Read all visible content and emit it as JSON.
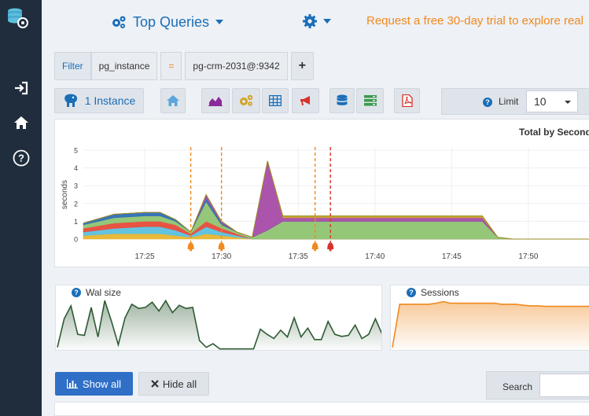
{
  "header": {
    "title": "Top Queries",
    "promo": "Request a free 30-day trial to explore real"
  },
  "filter": {
    "label": "Filter",
    "field": "pg_instance",
    "operator": "=",
    "value": "pg-crm-2031@:9342",
    "add_symbol": "+"
  },
  "toolbar": {
    "instance_label": "1 Instance",
    "limit_label": "Limit",
    "limit_value": "10",
    "colors": {
      "home": "#5ba6dc",
      "area": "#8b2a9a",
      "gears": "#d3a321",
      "grid": "#1a6eb8",
      "announce": "#d9322a",
      "database": "#1a6eb8",
      "server": "#3a9a4a",
      "pdf": "#d9322a"
    }
  },
  "main_chart": {
    "title": "Total by Seconds",
    "chart_data": {
      "type": "area",
      "ylabel": "seconds",
      "ylim": [
        0,
        5
      ],
      "yticks": [
        "0",
        "1",
        "2",
        "3",
        "4",
        "5"
      ],
      "xticks": [
        "17:25",
        "17:30",
        "17:35",
        "17:40",
        "17:45",
        "17:50"
      ],
      "x_minutes": [
        0,
        2,
        4,
        5,
        6,
        7,
        8,
        9,
        10,
        11,
        12,
        13,
        14,
        15,
        16,
        17,
        18,
        19,
        20,
        21,
        22,
        23,
        24,
        25,
        26,
        27,
        28,
        29,
        30,
        31,
        32,
        33
      ],
      "xtick_minutes": [
        4,
        9,
        14,
        19,
        24,
        29
      ],
      "series": [
        {
          "color": "#e8b530",
          "values": [
            0.2,
            0.3,
            0.3,
            0.3,
            0.2,
            0.1,
            0.3,
            0.2,
            0.1,
            0,
            0,
            0,
            0,
            0,
            0,
            0,
            0,
            0,
            0,
            0,
            0,
            0,
            0,
            0,
            0,
            0,
            0,
            0,
            0,
            0,
            0,
            0
          ]
        },
        {
          "color": "#5bc0de",
          "values": [
            0.2,
            0.3,
            0.4,
            0.4,
            0.3,
            0.1,
            0.4,
            0.2,
            0.1,
            0,
            0,
            0,
            0,
            0,
            0,
            0,
            0,
            0,
            0,
            0,
            0,
            0,
            0,
            0,
            0,
            0,
            0,
            0,
            0,
            0,
            0,
            0
          ]
        },
        {
          "color": "#e84a3a",
          "values": [
            0.2,
            0.3,
            0.3,
            0.3,
            0.3,
            0.1,
            0.3,
            0.2,
            0.1,
            0,
            0,
            0,
            0,
            0,
            0,
            0,
            0,
            0,
            0,
            0,
            0,
            0,
            0,
            0,
            0,
            0,
            0,
            0,
            0,
            0,
            0,
            0
          ]
        },
        {
          "color": "#8fc471",
          "values": [
            0.2,
            0.3,
            0.3,
            0.3,
            0.2,
            0.1,
            1.1,
            0.2,
            0.1,
            0.1,
            0.5,
            1.0,
            1.0,
            1.0,
            1.0,
            1.0,
            1.0,
            1.0,
            1.0,
            1.0,
            1.0,
            1.0,
            1.0,
            1.0,
            1.0,
            0.1,
            0,
            0,
            0,
            0,
            0,
            0
          ]
        },
        {
          "color": "#2d6fb5",
          "values": [
            0.1,
            0.2,
            0.2,
            0.2,
            0.1,
            0,
            0.2,
            0.1,
            0,
            0,
            0,
            0,
            0,
            0,
            0,
            0,
            0,
            0,
            0,
            0,
            0,
            0,
            0,
            0,
            0,
            0,
            0,
            0,
            0,
            0,
            0,
            0
          ]
        },
        {
          "color": "#a64ba8",
          "values": [
            0,
            0,
            0,
            0,
            0,
            0,
            0.2,
            0.1,
            0,
            0,
            3.9,
            0.2,
            0.2,
            0.2,
            0.2,
            0.2,
            0.2,
            0.2,
            0.2,
            0.2,
            0.2,
            0.2,
            0.2,
            0.2,
            0.2,
            0,
            0,
            0,
            0,
            0,
            0,
            0
          ]
        },
        {
          "color": "#c8a22a",
          "values": [
            0,
            0,
            0,
            0,
            0,
            0,
            0,
            0,
            0,
            0,
            0,
            0.1,
            0.1,
            0.1,
            0.1,
            0.1,
            0.1,
            0.1,
            0.1,
            0.1,
            0.1,
            0.1,
            0.1,
            0.1,
            0.1,
            0,
            0,
            0,
            0,
            0,
            0,
            0
          ]
        }
      ],
      "markers": [
        {
          "minute": 7.0,
          "color": "#f0891f"
        },
        {
          "minute": 9.0,
          "color": "#f0891f"
        },
        {
          "minute": 15.1,
          "color": "#f0891f"
        },
        {
          "minute": 16.1,
          "color": "#d9322a"
        }
      ]
    }
  },
  "wal_panel": {
    "title": "Wal size",
    "chart_data": {
      "type": "area",
      "color": "#2d5a33",
      "values": [
        0.05,
        0.6,
        0.85,
        0.3,
        0.28,
        0.82,
        0.25,
        0.95,
        0.55,
        0.1,
        0.62,
        0.88,
        0.8,
        0.82,
        0.92,
        0.75,
        0.95,
        0.72,
        0.86,
        0.8,
        0.82,
        0.18,
        0.05,
        0.12,
        0.02,
        0.02,
        0.02,
        0.02,
        0.02,
        0.02,
        0.4,
        0.3,
        0.22,
        0.38,
        0.25,
        0.62,
        0.25,
        0.42,
        0.2,
        0.2,
        0.55,
        0.3,
        0.26,
        0.28,
        0.48,
        0.22,
        0.3,
        0.6,
        0.3
      ]
    }
  },
  "sessions_panel": {
    "title": "Sessions",
    "chart_data": {
      "type": "area",
      "color": "#f0891f",
      "values": [
        0.05,
        0.88,
        0.88,
        0.88,
        0.88,
        0.88,
        0.9,
        0.93,
        0.9,
        0.9,
        0.9,
        0.9,
        0.9,
        0.9,
        0.9,
        0.88,
        0.88,
        0.88,
        0.86,
        0.85,
        0.85,
        0.84,
        0.84,
        0.84,
        0.84,
        0.84,
        0.84,
        0.84
      ]
    }
  },
  "bottom": {
    "show_all": "Show all",
    "hide_all": "Hide all",
    "search_label": "Search"
  }
}
